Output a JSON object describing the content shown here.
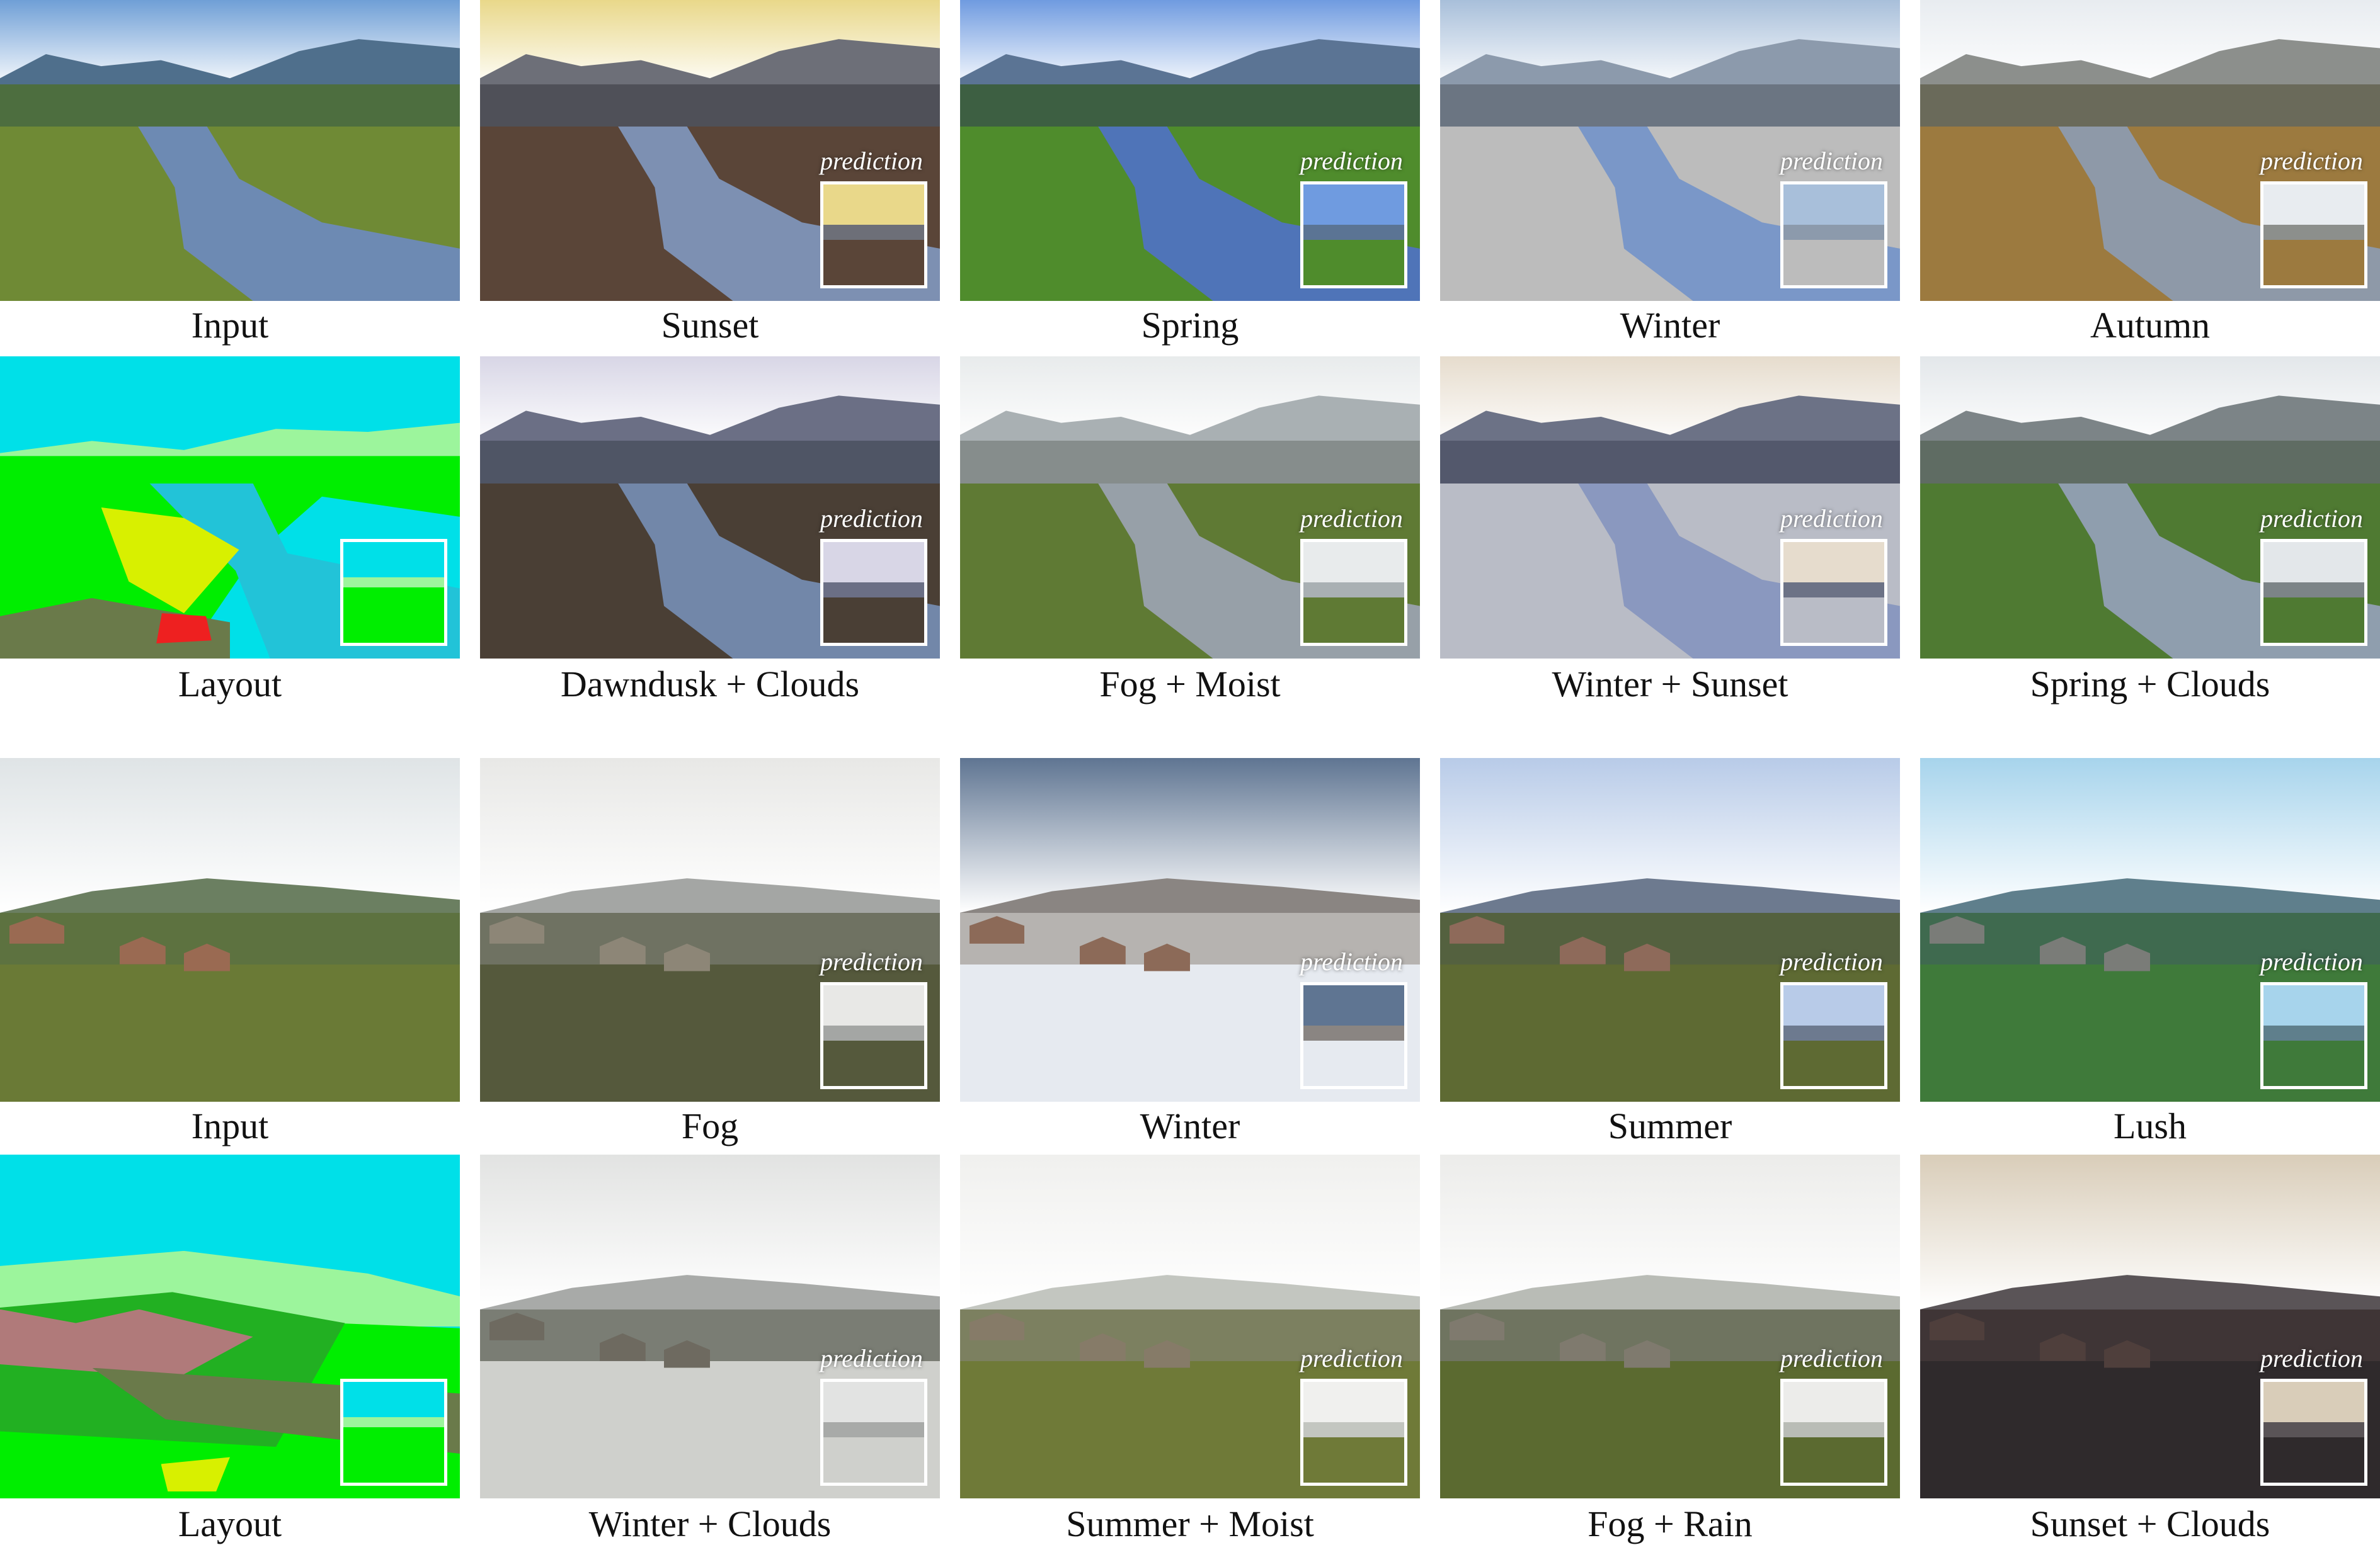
{
  "inset_label": "prediction",
  "blocks": [
    {
      "name": "river-scene",
      "rows": [
        {
          "cells": [
            {
              "caption": "Input",
              "style": "input-river",
              "inset": false
            },
            {
              "caption": "Sunset",
              "style": "sunset-river",
              "inset": true
            },
            {
              "caption": "Spring",
              "style": "spring-river",
              "inset": true
            },
            {
              "caption": "Winter",
              "style": "winter-river",
              "inset": true
            },
            {
              "caption": "Autumn",
              "style": "autumn-river",
              "inset": true
            }
          ]
        },
        {
          "cells": [
            {
              "caption": "Layout",
              "style": "layout-river",
              "inset": true
            },
            {
              "caption": "Dawndusk + Clouds",
              "style": "dawn-river",
              "inset": true
            },
            {
              "caption": "Fog + Moist",
              "style": "fog-river",
              "inset": true
            },
            {
              "caption": "Winter + Sunset",
              "style": "wsun-river",
              "inset": true
            },
            {
              "caption": "Spring + Clouds",
              "style": "sclouds-river",
              "inset": true
            }
          ]
        }
      ]
    },
    {
      "name": "village-scene",
      "rows": [
        {
          "cells": [
            {
              "caption": "Input",
              "style": "input-village",
              "inset": false
            },
            {
              "caption": "Fog",
              "style": "fog-village",
              "inset": true
            },
            {
              "caption": "Winter",
              "style": "winter-village",
              "inset": true
            },
            {
              "caption": "Summer",
              "style": "summer-village",
              "inset": true
            },
            {
              "caption": "Lush",
              "style": "lush-village",
              "inset": true
            }
          ]
        },
        {
          "cells": [
            {
              "caption": "Layout",
              "style": "layout-village",
              "inset": true
            },
            {
              "caption": "Winter + Clouds",
              "style": "wclouds-village",
              "inset": true
            },
            {
              "caption": "Summer + Moist",
              "style": "smoist-village",
              "inset": true
            },
            {
              "caption": "Fog + Rain",
              "style": "frain-village",
              "inset": true
            },
            {
              "caption": "Sunset + Clouds",
              "style": "sclouds-village",
              "inset": true
            }
          ]
        }
      ]
    }
  ],
  "palettes": {
    "input-river": {
      "sky": "#6f9fd6",
      "far": "#4f6f8c",
      "hill": "#4d6e3f",
      "ground": "#6f8a35",
      "water": "#6d8ab3"
    },
    "sunset-river": {
      "sky": "#e9d88a",
      "far": "#6d6f78",
      "hill": "#4f5058",
      "ground": "#5a4538",
      "water": "#7d90b2"
    },
    "spring-river": {
      "sky": "#6f9be0",
      "far": "#5b7494",
      "hill": "#3d5f42",
      "ground": "#4f8c2c",
      "water": "#4f74b8"
    },
    "winter-river": {
      "sky": "#a8bfda",
      "far": "#8c9aac",
      "hill": "#6b7582",
      "ground": "#bcbcbc",
      "water": "#7a97c8"
    },
    "autumn-river": {
      "sky": "#e8ecf0",
      "far": "#8c8f8c",
      "hill": "#6a6a5a",
      "ground": "#9c7a3f",
      "water": "#8e99a8"
    },
    "dawn-river": {
      "sky": "#d8d6e6",
      "far": "#6b6f85",
      "hill": "#4f5565",
      "ground": "#4a3f35",
      "water": "#7287a9"
    },
    "fog-river": {
      "sky": "#e8ebec",
      "far": "#a9b0b3",
      "hill": "#868d8c",
      "ground": "#5f7a34",
      "water": "#97a0a8"
    },
    "wsun-river": {
      "sky": "#e6dccd",
      "far": "#6c7286",
      "hill": "#53586c",
      "ground": "#b9bcc6",
      "water": "#8a98bf"
    },
    "sclouds-river": {
      "sky": "#e3e7ea",
      "far": "#7c8487",
      "hill": "#5f6c63",
      "ground": "#4f7a32",
      "water": "#8f9eae"
    },
    "input-village": {
      "sky": "#dfe4e6",
      "far": "#6b7f61",
      "hill": "#5d7240",
      "ground": "#6a7a36",
      "house": "#9a6a52"
    },
    "fog-village": {
      "sky": "#e8e8e6",
      "far": "#a4a6a4",
      "hill": "#6f7262",
      "ground": "#55593c",
      "house": "#8d8677"
    },
    "winter-village": {
      "sky": "#5f7592",
      "far": "#8a8582",
      "hill": "#b6b3b0",
      "ground": "#e6eaf0",
      "house": "#8c6a58"
    },
    "summer-village": {
      "sky": "#b8cbe8",
      "far": "#6d7a8f",
      "hill": "#54613f",
      "ground": "#5e6a33",
      "house": "#8e6a5a"
    },
    "lush-village": {
      "sky": "#a7d4ec",
      "far": "#5f7f8c",
      "hill": "#3f6a4f",
      "ground": "#3f7a3a",
      "house": "#7a7c78"
    },
    "wclouds-village": {
      "sky": "#e2e3e2",
      "far": "#a8aaa8",
      "hill": "#7a7d74",
      "ground": "#cfd0cc",
      "house": "#6e6a60"
    },
    "smoist-village": {
      "sky": "#f0f0ee",
      "far": "#c3c6c0",
      "hill": "#7c8060",
      "ground": "#6f7a38",
      "house": "#867b68"
    },
    "frain-village": {
      "sky": "#ececea",
      "far": "#b9bcb6",
      "hill": "#6f7460",
      "ground": "#5b6a30",
      "house": "#7f7a6e"
    },
    "sclouds-village": {
      "sky": "#d9cdb9",
      "far": "#5a5457",
      "hill": "#3f3536",
      "ground": "#2f2a2c",
      "house": "#4f3f3c"
    }
  }
}
